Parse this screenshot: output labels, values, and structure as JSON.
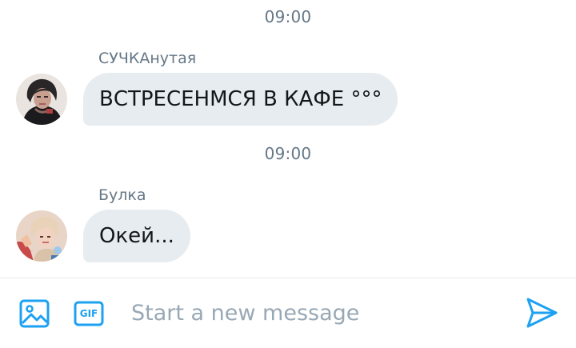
{
  "conversation": {
    "messages": [
      {
        "time": "09:00",
        "sender": "СУЧКАнутая",
        "text": "ВСТРЕСЕНМСЯ В КАФЕ °°°"
      },
      {
        "time": "09:00",
        "sender": "Булка",
        "text": "Окей..."
      }
    ]
  },
  "composer": {
    "placeholder": "Start a new message",
    "photo_icon": "image-icon",
    "gif_label": "GIF",
    "send_icon": "send-icon"
  },
  "colors": {
    "accent": "#1da1f2",
    "bubble": "#e6ecf0",
    "meta_text": "#657786",
    "placeholder": "#98a8b5"
  }
}
